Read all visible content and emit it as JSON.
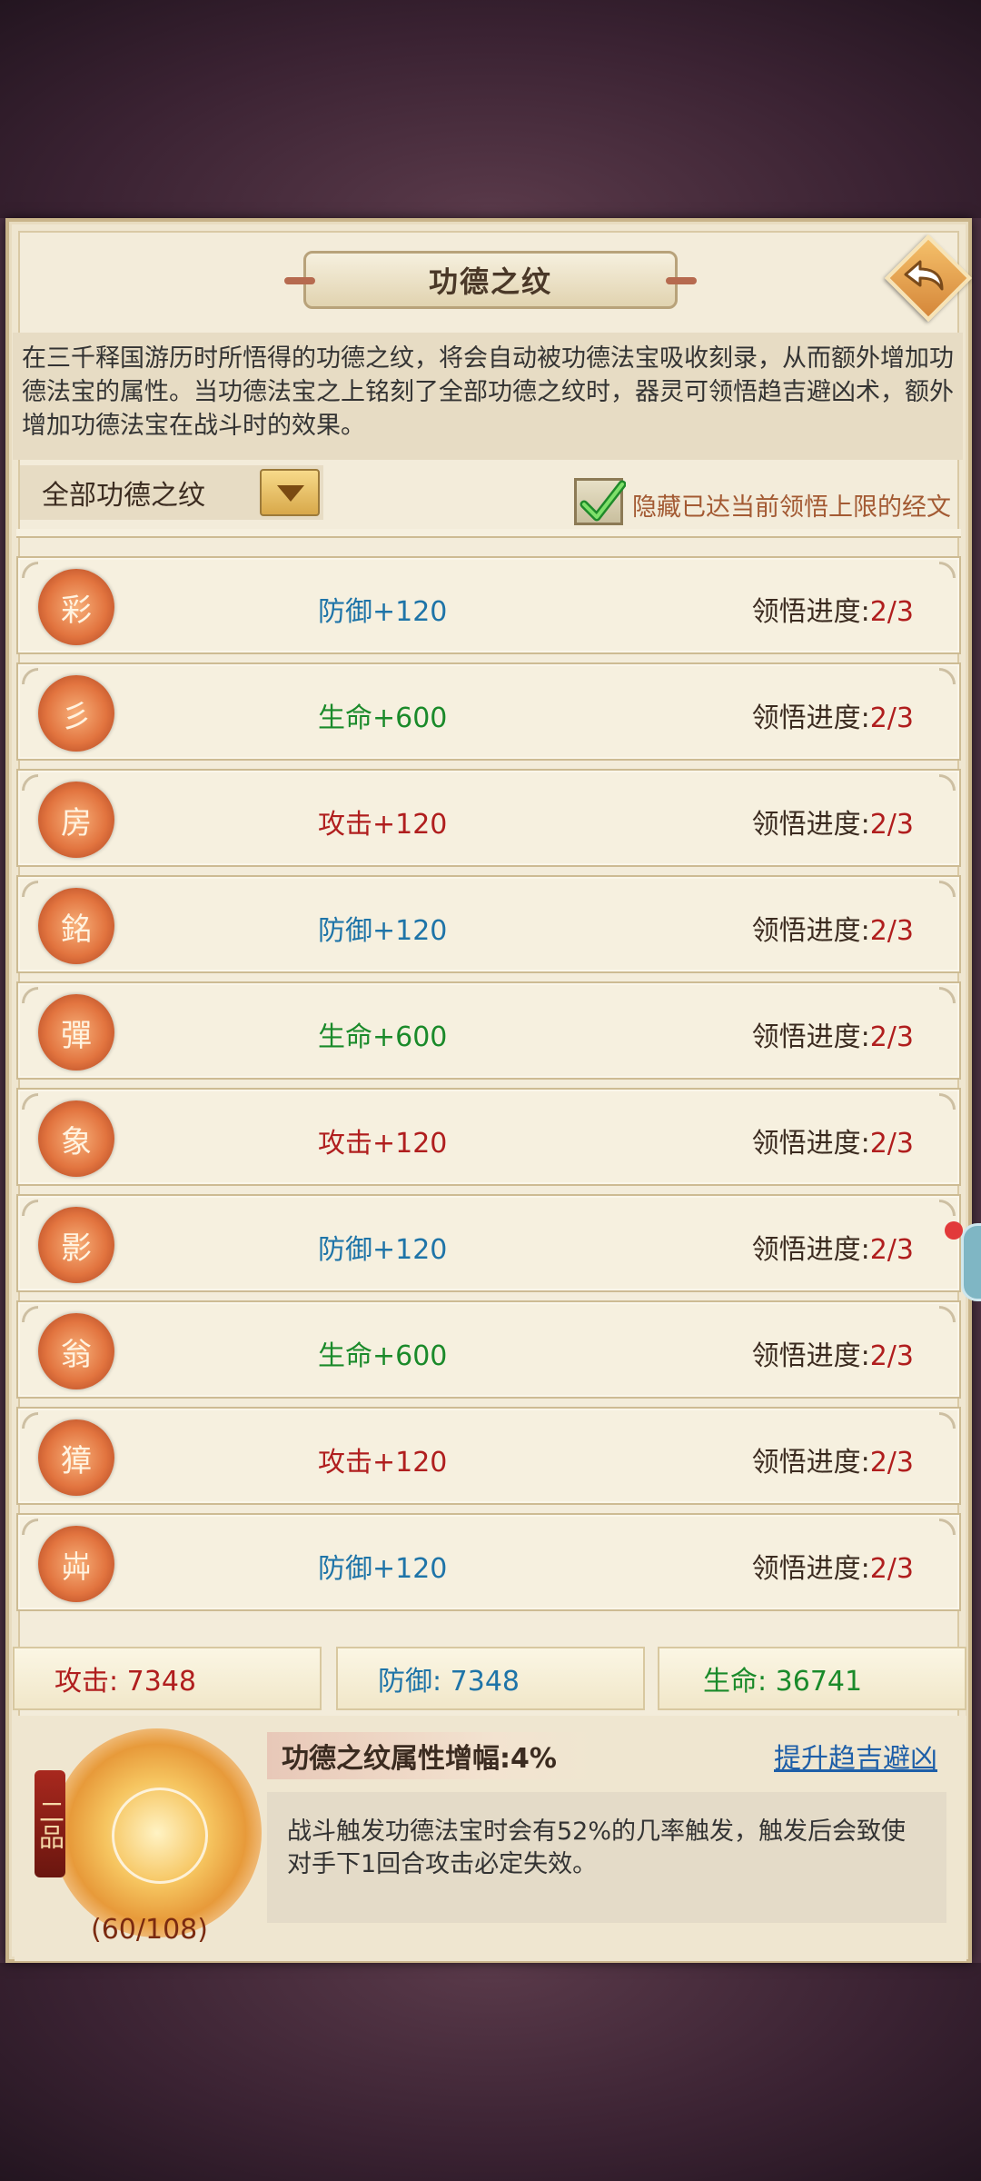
{
  "title": "功德之纹",
  "description": "在三千释国游历时所悟得的功德之纹，将会自动被功德法宝吸收刻录，从而额外增加功德法宝的属性。当功德法宝之上铭刻了全部功德之纹时，器灵可领悟趋吉避凶术，额外增加功德法宝在战斗时的效果。",
  "filter": {
    "label": "全部功德之纹"
  },
  "hide_toggle": {
    "label": "隐藏已达当前领悟上限的经文",
    "checked": true
  },
  "progress_label": "领悟进度:",
  "rows": [
    {
      "rune": "彩",
      "stat": "防御+120",
      "kind": "def",
      "progress": "2/3"
    },
    {
      "rune": "彡",
      "stat": "生命+600",
      "kind": "hp",
      "progress": "2/3"
    },
    {
      "rune": "房",
      "stat": "攻击+120",
      "kind": "atk",
      "progress": "2/3"
    },
    {
      "rune": "銘",
      "stat": "防御+120",
      "kind": "def",
      "progress": "2/3"
    },
    {
      "rune": "彈",
      "stat": "生命+600",
      "kind": "hp",
      "progress": "2/3"
    },
    {
      "rune": "象",
      "stat": "攻击+120",
      "kind": "atk",
      "progress": "2/3"
    },
    {
      "rune": "影",
      "stat": "防御+120",
      "kind": "def",
      "progress": "2/3"
    },
    {
      "rune": "翁",
      "stat": "生命+600",
      "kind": "hp",
      "progress": "2/3"
    },
    {
      "rune": "獐",
      "stat": "攻击+120",
      "kind": "atk",
      "progress": "2/3"
    },
    {
      "rune": "芔",
      "stat": "防御+120",
      "kind": "def",
      "progress": "2/3"
    }
  ],
  "totals": {
    "attack": "攻击: 7348",
    "defense": "防御: 7348",
    "life": "生命: 36741"
  },
  "treasure": {
    "rank": "二品",
    "count": "(60/108)",
    "boost": "功德之纹属性增幅:4%",
    "upgrade_link": "提升趋吉避凶",
    "effect": "战斗触发功德法宝时会有52%的几率触发，触发后会致使对手下1回合攻击必定失效。"
  },
  "colors": {
    "defense": "#1e74a8",
    "life": "#1a8a2a",
    "attack": "#b01e1e",
    "progress_value": "#b01e1e"
  },
  "icons": {
    "back": "back-arrow-icon",
    "dropdown": "triangle-down-icon",
    "check": "checkmark-icon"
  }
}
